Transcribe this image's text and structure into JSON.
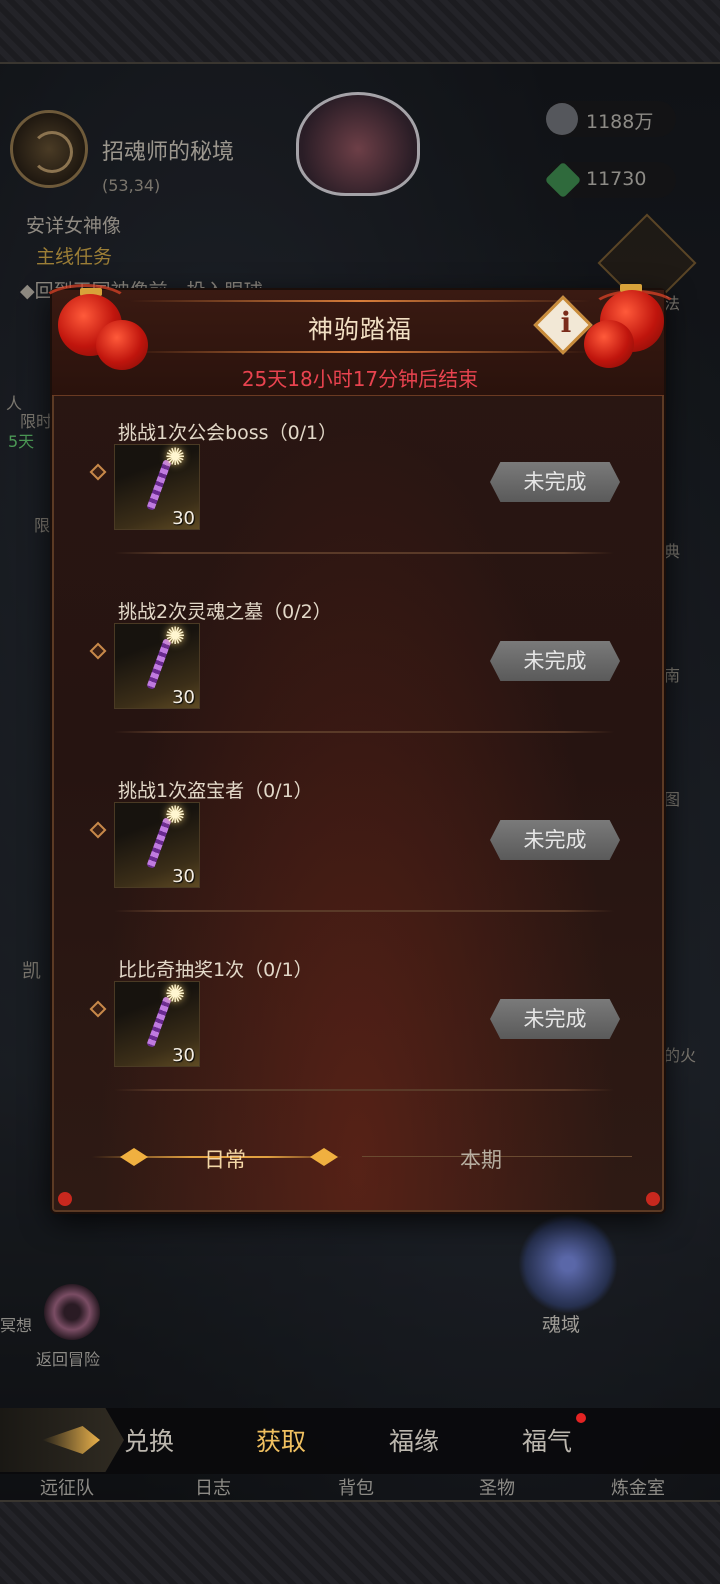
{
  "hud": {
    "zone_title": "招魂师的秘境",
    "zone_coords": "(53,34)",
    "quest_name": "安详女神像",
    "quest_type": "主线任务",
    "quest_desc": "◆回到王国神像前，投入眼球",
    "currency_1": "1188万",
    "currency_2": "11730",
    "side_labels": [
      "法",
      "典",
      "南",
      "图",
      "的火"
    ],
    "left_stubs": [
      "人",
      "限时",
      "5天",
      "限",
      "凯"
    ],
    "realm_label": "魂域",
    "return_label": "返回冒险",
    "left_cut_label": "冥想"
  },
  "popup": {
    "title": "神驹踏福",
    "countdown": "25天18小时17分钟后结束",
    "info_icon": "info-icon",
    "tasks": [
      {
        "title": "挑战1次公会boss（0/1）",
        "reward_qty": "30",
        "status": "未完成"
      },
      {
        "title": "挑战2次灵魂之墓（0/2）",
        "reward_qty": "30",
        "status": "未完成"
      },
      {
        "title": "挑战1次盗宝者（0/1）",
        "reward_qty": "30",
        "status": "未完成"
      },
      {
        "title": "比比奇抽奖1次（0/1）",
        "reward_qty": "30",
        "status": "未完成"
      }
    ],
    "sub_tabs": [
      {
        "label": "日常",
        "active": true
      },
      {
        "label": "本期",
        "active": false
      }
    ]
  },
  "bottom_tabs": [
    {
      "label": "兑换",
      "active": false
    },
    {
      "label": "获取",
      "active": true
    },
    {
      "label": "福缘",
      "active": false
    },
    {
      "label": "福气",
      "active": false,
      "badge": true
    }
  ],
  "bottom_nav": [
    "远征队",
    "日志",
    "背包",
    "圣物",
    "炼金室"
  ],
  "colors": {
    "accent_gold": "#f0c060",
    "countdown_red": "#e8434f",
    "panel_bg": "#2a1612",
    "status_grey": "#6a6a6a"
  }
}
